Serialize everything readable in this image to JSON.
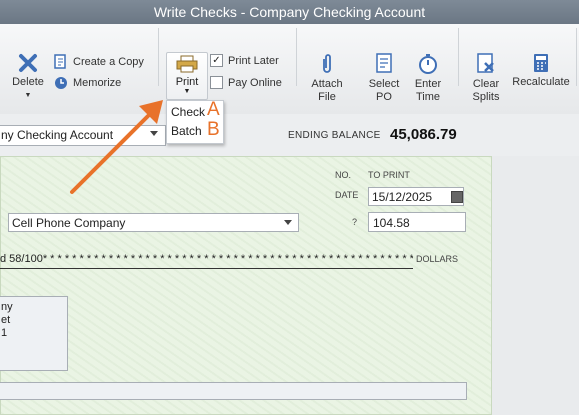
{
  "window": {
    "title": "Write Checks - Company Checking Account"
  },
  "toolbar": {
    "delete_label": "Delete",
    "create_copy_label": "Create a Copy",
    "memorize_label": "Memorize",
    "print_label": "Print",
    "print_later_label": "Print Later",
    "print_later_checked": true,
    "pay_online_label": "Pay Online",
    "pay_online_checked": false,
    "attach_label_1": "Attach",
    "attach_label_2": "File",
    "select_label_1": "Select",
    "select_label_2": "PO",
    "enter_label_1": "Enter",
    "enter_label_2": "Time",
    "clear_label_1": "Clear",
    "clear_label_2": "Splits",
    "recalculate_label": "Recalculate",
    "check_mark": "✓"
  },
  "print_menu": {
    "items": [
      {
        "label": "Check",
        "letter": "A"
      },
      {
        "label": "Batch",
        "letter": "B"
      }
    ]
  },
  "account": {
    "selected": "ny Checking Account",
    "ending_balance_label": "ENDING BALANCE",
    "ending_balance_value": "45,086.79"
  },
  "check": {
    "no_label": "NO.",
    "no_value": "TO PRINT",
    "date_label": "DATE",
    "date_value": "15/12/2025",
    "payee": "Cell Phone Company",
    "amount_label": "?",
    "amount": "104.58",
    "amount_words": "d 58/100* * * * * * * * * * * * * * * * * * * * * * * * * * * * * * * * * * * * * * * * * * * * * * * * * * * * * * * * * * * * * *",
    "dollars_label": "DOLLARS",
    "address_lines": [
      "ny",
      "et",
      "1"
    ]
  },
  "colors": {
    "accent_orange": "#e8722a",
    "check_bg": "#eaf4e4"
  }
}
